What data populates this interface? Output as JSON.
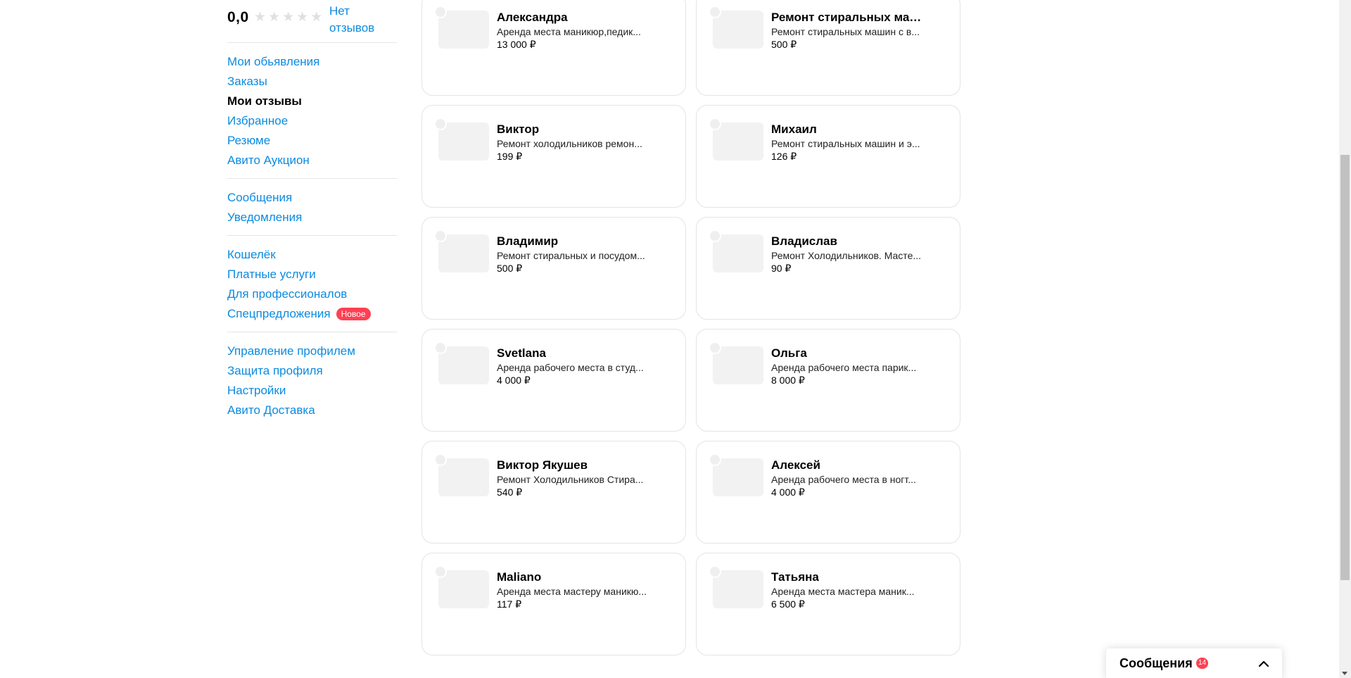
{
  "sidebar": {
    "rating_value": "0,0",
    "stars_filled": 0,
    "stars_total": 5,
    "no_reviews": "Нет отзывов",
    "groups": [
      [
        {
          "label": "Мои обьявления",
          "active": false
        },
        {
          "label": "Заказы",
          "active": false
        },
        {
          "label": "Мои отзывы",
          "active": true
        },
        {
          "label": "Избранное",
          "active": false
        },
        {
          "label": "Резюме",
          "active": false
        },
        {
          "label": "Авито Аукцион",
          "active": false
        }
      ],
      [
        {
          "label": "Сообщения",
          "active": false
        },
        {
          "label": "Уведомления",
          "active": false
        }
      ],
      [
        {
          "label": "Кошелёк",
          "active": false
        },
        {
          "label": "Платные услуги",
          "active": false
        },
        {
          "label": "Для профессионалов",
          "active": false
        },
        {
          "label": "Спецпредложения",
          "active": false,
          "badge": "Новое"
        }
      ],
      [
        {
          "label": "Управление профилем",
          "active": false
        },
        {
          "label": "Защита профиля",
          "active": false
        },
        {
          "label": "Настройки",
          "active": false
        },
        {
          "label": "Авито Доставка",
          "active": false
        }
      ]
    ]
  },
  "cards": [
    {
      "name": "Александра",
      "desc": "Аренда места маникюр,педик...",
      "price": "13 000 ₽"
    },
    {
      "name": "Ремонт стиральных маши...",
      "desc": "Ремонт стиральных машин с в...",
      "price": "500 ₽"
    },
    {
      "name": "Виктор",
      "desc": "Ремонт холодильников ремон...",
      "price": "199 ₽"
    },
    {
      "name": "Михаил",
      "desc": "Ремонт стиральных машин и э...",
      "price": "126 ₽"
    },
    {
      "name": "Владимир",
      "desc": "Ремонт стиральных и посудом...",
      "price": "500 ₽"
    },
    {
      "name": "Владислав",
      "desc": "Ремонт Холодильников. Масте...",
      "price": "90 ₽"
    },
    {
      "name": "Svetlana",
      "desc": "Аренда рабочего места в студ...",
      "price": "4 000 ₽"
    },
    {
      "name": "Ольга",
      "desc": "Аренда рабочего места парик...",
      "price": "8 000 ₽"
    },
    {
      "name": "Виктор Якушев",
      "desc": "Ремонт Холодильников Стира...",
      "price": "540 ₽"
    },
    {
      "name": "Алексей",
      "desc": "Аренда рабочего места в ногт...",
      "price": "4 000 ₽"
    },
    {
      "name": "Maliano",
      "desc": "Аренда места мастеру маникю...",
      "price": "117 ₽"
    },
    {
      "name": "Татьяна",
      "desc": "Аренда места мастера маник...",
      "price": "6 500 ₽"
    }
  ],
  "messenger": {
    "title": "Сообщения",
    "unread_count": "14",
    "chevron_icon": "chevron-up-icon"
  },
  "colors": {
    "link": "#0a8be0",
    "badge": "#ff4053",
    "card_border": "#e4e4e4",
    "thumb": "#f2f2f2"
  }
}
